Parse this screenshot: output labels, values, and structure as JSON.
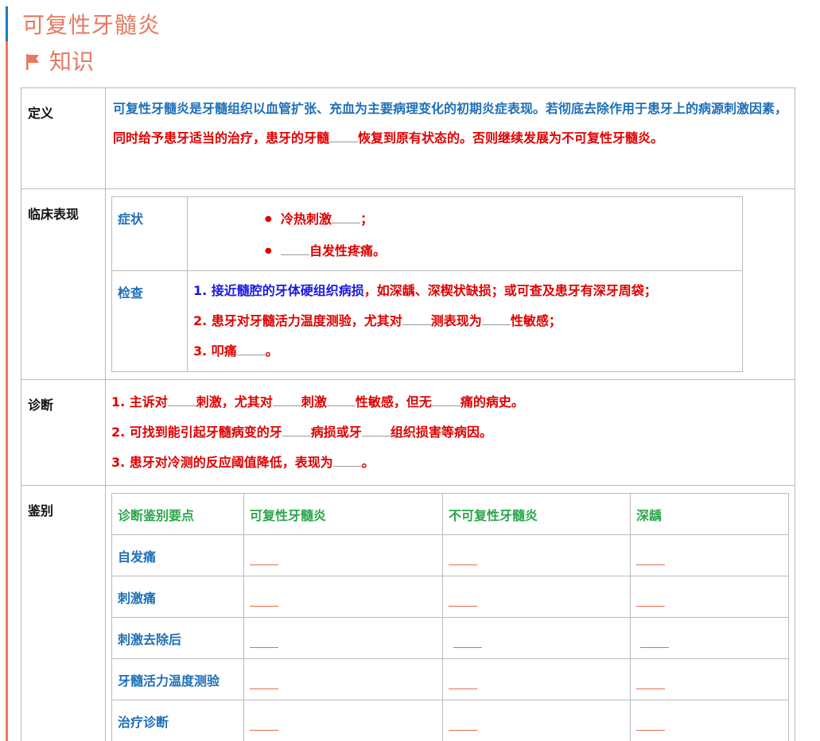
{
  "title": "可复性牙髓炎",
  "section": "知识",
  "rows": {
    "definition": {
      "label": "定义",
      "text_blue": "可复性牙髓炎是牙髓组织以血管扩张、充血为主要病理变化的初期炎症表现。若彻底去除作用于患牙上的病源刺激因素，",
      "text_red1": "同时给予患牙适当的治疗，患牙的牙髓",
      "text_red2": "恢复到原有状态的。否则继续发展为不可复性牙髓炎。"
    },
    "clinical": {
      "label": "临床表现",
      "symptom_label": "症状",
      "symptom1": "冷热刺激",
      "symptom1_tail": "；",
      "symptom2_tail": "自发性疼痛。",
      "exam_label": "检查",
      "exam1": "1. 接近髓腔的牙体硬组织病损",
      "exam1_tail": "，如深龋、深楔状缺损；或可查及患牙有深牙周袋；",
      "exam2_a": "2. 患牙对牙髓活力温度测验，尤其对",
      "exam2_b": "测表现为",
      "exam2_c": "性敏感；",
      "exam3_a": "3. 叩痛",
      "exam3_b": "。"
    },
    "diagnosis": {
      "label": "诊断",
      "d1_a": "1. 主诉对",
      "d1_b": "刺激，尤其对",
      "d1_c": "刺激",
      "d1_d": "性敏感，但无",
      "d1_e": "痛的病史。",
      "d2_a": "2. 可找到能引起牙髓病变的牙",
      "d2_b": "病损或牙",
      "d2_c": "组织损害等病因。",
      "d3_a": "3. 患牙对冷测的反应阈值降低，表现为",
      "d3_b": "。"
    },
    "differential": {
      "label": "鉴别",
      "headers": [
        "诊断鉴别要点",
        "可复性牙髓炎",
        "不可复性牙髓炎",
        "深龋"
      ],
      "row_labels": [
        "自发痛",
        "刺激痛",
        "刺激去除后",
        "牙髓活力温度测验",
        "治疗诊断"
      ]
    }
  },
  "colors": {
    "accent": "#e8785f",
    "blue": "#1e6fb8",
    "red": "#e00000",
    "green": "#2aa64a"
  }
}
